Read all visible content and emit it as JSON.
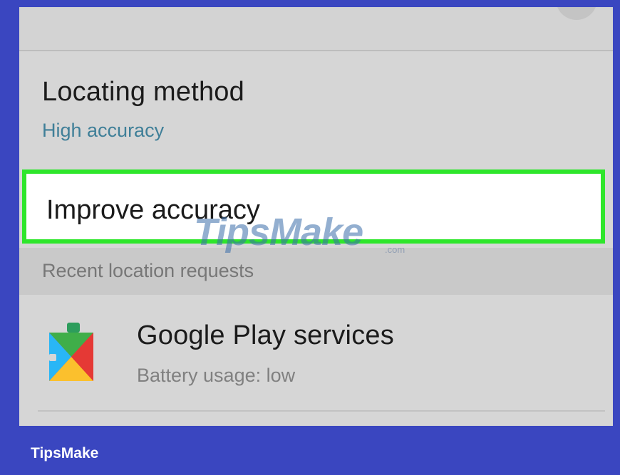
{
  "settings": {
    "locating_method": {
      "title": "Locating method",
      "value": "High accuracy"
    },
    "improve_accuracy": {
      "title": "Improve accuracy"
    },
    "recent_requests": {
      "header": "Recent location requests",
      "items": [
        {
          "app_name": "Google Play services",
          "detail": "Battery usage: low",
          "icon": "google-play-services-icon"
        }
      ]
    }
  },
  "watermark": {
    "text": "TipsMake",
    "suffix": ".com"
  },
  "footer": {
    "brand": "TipsMake"
  },
  "colors": {
    "frame": "#3a46c0",
    "highlight_border": "#2ee62b",
    "subtitle": "#3f7f98",
    "screen_background": "#d6d6d6"
  }
}
